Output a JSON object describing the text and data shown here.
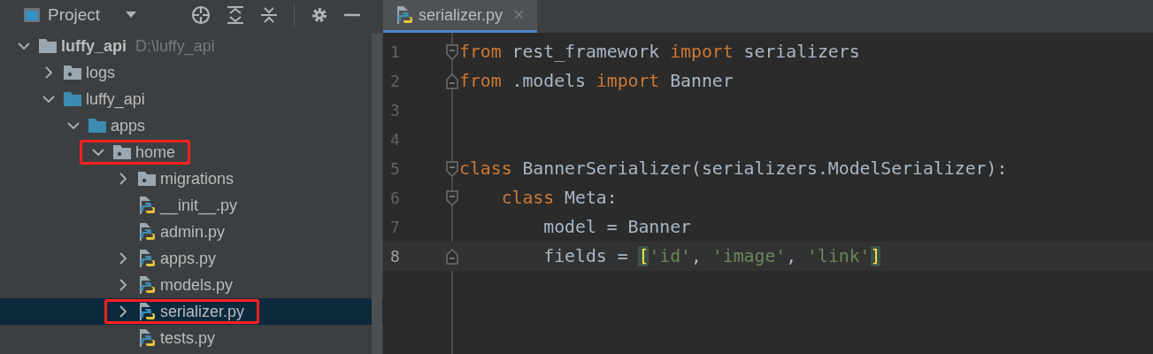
{
  "project_panel": {
    "title": "Project",
    "tree": [
      {
        "label": "luffy_api",
        "hint": "D:\\luffy_api",
        "kind": "root",
        "expanded": true,
        "selected": false,
        "highlighted": false,
        "children": [
          {
            "label": "logs",
            "kind": "folder",
            "expanded": false,
            "selected": false,
            "highlighted": false
          },
          {
            "label": "luffy_api",
            "kind": "package",
            "expanded": true,
            "selected": false,
            "highlighted": false,
            "children": [
              {
                "label": "apps",
                "kind": "package",
                "expanded": true,
                "selected": false,
                "highlighted": false,
                "children": [
                  {
                    "label": "home",
                    "kind": "folder",
                    "expanded": true,
                    "selected": false,
                    "highlighted": true,
                    "children": [
                      {
                        "label": "migrations",
                        "kind": "folder",
                        "expanded": false,
                        "selected": false,
                        "highlighted": false
                      },
                      {
                        "label": "__init__.py",
                        "kind": "python",
                        "selected": false,
                        "highlighted": false
                      },
                      {
                        "label": "admin.py",
                        "kind": "python",
                        "selected": false,
                        "highlighted": false
                      },
                      {
                        "label": "apps.py",
                        "kind": "python",
                        "expanded": false,
                        "selected": false,
                        "highlighted": false
                      },
                      {
                        "label": "models.py",
                        "kind": "python",
                        "expanded": false,
                        "selected": false,
                        "highlighted": false
                      },
                      {
                        "label": "serializer.py",
                        "kind": "python",
                        "expanded": false,
                        "selected": true,
                        "highlighted": true
                      },
                      {
                        "label": "tests.py",
                        "kind": "python",
                        "selected": false,
                        "highlighted": false
                      }
                    ]
                  }
                ]
              }
            ]
          }
        ]
      }
    ]
  },
  "editor": {
    "tabs": [
      {
        "label": "serializer.py",
        "close": "×",
        "selected": true
      }
    ],
    "lines": [
      {
        "number": "1",
        "fold_start": true,
        "fold_end": false,
        "current": false,
        "tokens": [
          {
            "kind": "keyword",
            "text": "from"
          },
          {
            "kind": "plain",
            "text": " rest_framework "
          },
          {
            "kind": "keyword",
            "text": "import"
          },
          {
            "kind": "plain",
            "text": " serializers"
          }
        ]
      },
      {
        "number": "2",
        "fold_start": false,
        "fold_end": true,
        "current": false,
        "tokens": [
          {
            "kind": "keyword",
            "text": "from"
          },
          {
            "kind": "plain",
            "text": " .models "
          },
          {
            "kind": "keyword",
            "text": "import"
          },
          {
            "kind": "plain",
            "text": " Banner"
          }
        ]
      },
      {
        "number": "3",
        "fold_start": false,
        "fold_end": false,
        "current": false
      },
      {
        "number": "4",
        "fold_start": false,
        "fold_end": false,
        "current": false
      },
      {
        "number": "5",
        "fold_start": true,
        "fold_end": false,
        "current": false,
        "tokens": [
          {
            "kind": "keyword",
            "text": "class"
          },
          {
            "kind": "plain",
            "text": " BannerSerializer(serializers.ModelSerializer):"
          }
        ]
      },
      {
        "number": "6",
        "fold_start": true,
        "fold_end": false,
        "current": false,
        "tokens": [
          {
            "kind": "keyword",
            "text": "    class"
          },
          {
            "kind": "plain",
            "text": " Meta:"
          }
        ]
      },
      {
        "number": "7",
        "fold_start": false,
        "fold_end": false,
        "current": false,
        "tokens": [
          {
            "kind": "plain",
            "text": "        model = Banner"
          }
        ]
      },
      {
        "number": "8",
        "fold_start": false,
        "fold_end": true,
        "current": true,
        "tokens": [
          {
            "kind": "plain",
            "text": "        fields = "
          },
          {
            "kind": "bracket",
            "text": "["
          },
          {
            "kind": "string",
            "text": "'id'"
          },
          {
            "kind": "plain",
            "text": ", "
          },
          {
            "kind": "string",
            "text": "'image'"
          },
          {
            "kind": "plain",
            "text": ", "
          },
          {
            "kind": "string",
            "text": "'link'"
          },
          {
            "kind": "bracket",
            "text": "]"
          }
        ]
      }
    ]
  }
}
